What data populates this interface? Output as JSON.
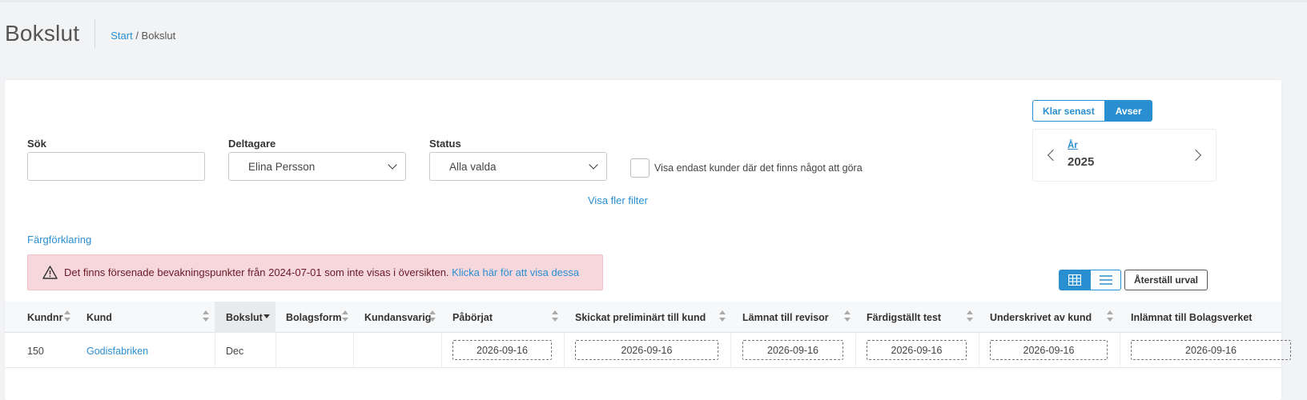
{
  "page": {
    "title": "Bokslut"
  },
  "breadcrumb": {
    "home": "Start",
    "separator": " / ",
    "current": "Bokslut"
  },
  "filters": {
    "search_label": "Sök",
    "search_value": "",
    "participant_label": "Deltagare",
    "participant_value": "Elina Persson",
    "status_label": "Status",
    "status_value": "Alla valda",
    "only_todo_label": "Visa endast kunder där det finns något att göra",
    "more_filters": "Visa fler filter"
  },
  "period": {
    "toggle_left": "Klar senast",
    "toggle_right": "Avser",
    "year_label": "År",
    "year_value": "2025"
  },
  "legend_link": "Färgförklaring",
  "alert": {
    "text": "Det finns försenade bevakningspunkter från 2024-07-01 som inte visas i översikten.",
    "link": "Klicka här för att visa dessa"
  },
  "view": {
    "reset_label": "Återställ urval"
  },
  "table": {
    "columns": [
      "Kundnr",
      "Kund",
      "Bokslut",
      "Bolagsform",
      "Kundansvarig",
      "Påbörjat",
      "Skickat preliminärt till kund",
      "Lämnat till revisor",
      "Färdigställt test",
      "Underskrivet av kund",
      "Inlämnat till Bolagsverket"
    ],
    "rows": [
      {
        "kundnr": "150",
        "kund": "Godisfabriken",
        "bokslut": "Dec",
        "bolagsform": "",
        "kundansvarig": "",
        "dates": [
          "2026-09-16",
          "2026-09-16",
          "2026-09-16",
          "2026-09-16",
          "2026-09-16",
          "2026-09-16"
        ]
      }
    ]
  },
  "colors": {
    "accent": "#2a8fd1",
    "alert_bg": "#f5d7dc"
  }
}
